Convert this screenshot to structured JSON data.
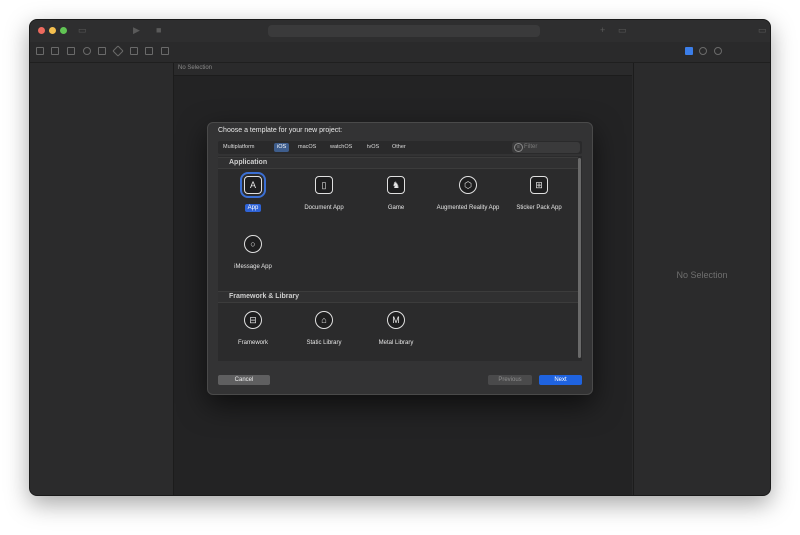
{
  "window": {
    "colors": {
      "close": "#ed6a5e",
      "minimize": "#f5bf4f",
      "zoom": "#61c554",
      "accent": "#1f63e0"
    }
  },
  "editor": {
    "empty_label": "No Selection"
  },
  "inspector": {
    "empty_label": "No Selection"
  },
  "dialog": {
    "title": "Choose a template for your new project:",
    "tabs": [
      {
        "label": "Multiplatform"
      },
      {
        "label": "iOS",
        "active": true
      },
      {
        "label": "macOS"
      },
      {
        "label": "watchOS"
      },
      {
        "label": "tvOS"
      },
      {
        "label": "Other"
      }
    ],
    "filter": {
      "placeholder": "Filter"
    },
    "sections": [
      {
        "label": "Application",
        "templates": [
          {
            "label": "App",
            "icon": "app-store-icon",
            "selected": true
          },
          {
            "label": "Document App",
            "icon": "document-icon"
          },
          {
            "label": "Game",
            "icon": "game-icon"
          },
          {
            "label": "Augmented Reality App",
            "icon": "ar-cube-icon"
          },
          {
            "label": "Sticker Pack App",
            "icon": "sticker-grid-icon"
          },
          {
            "label": "iMessage App",
            "icon": "message-bubble-icon"
          }
        ]
      },
      {
        "label": "Framework & Library",
        "templates": [
          {
            "label": "Framework",
            "icon": "framework-briefcase-icon"
          },
          {
            "label": "Static Library",
            "icon": "library-building-icon"
          },
          {
            "label": "Metal Library",
            "icon": "metal-icon"
          }
        ]
      }
    ],
    "buttons": {
      "cancel": "Cancel",
      "previous": "Previous",
      "next": "Next"
    }
  }
}
